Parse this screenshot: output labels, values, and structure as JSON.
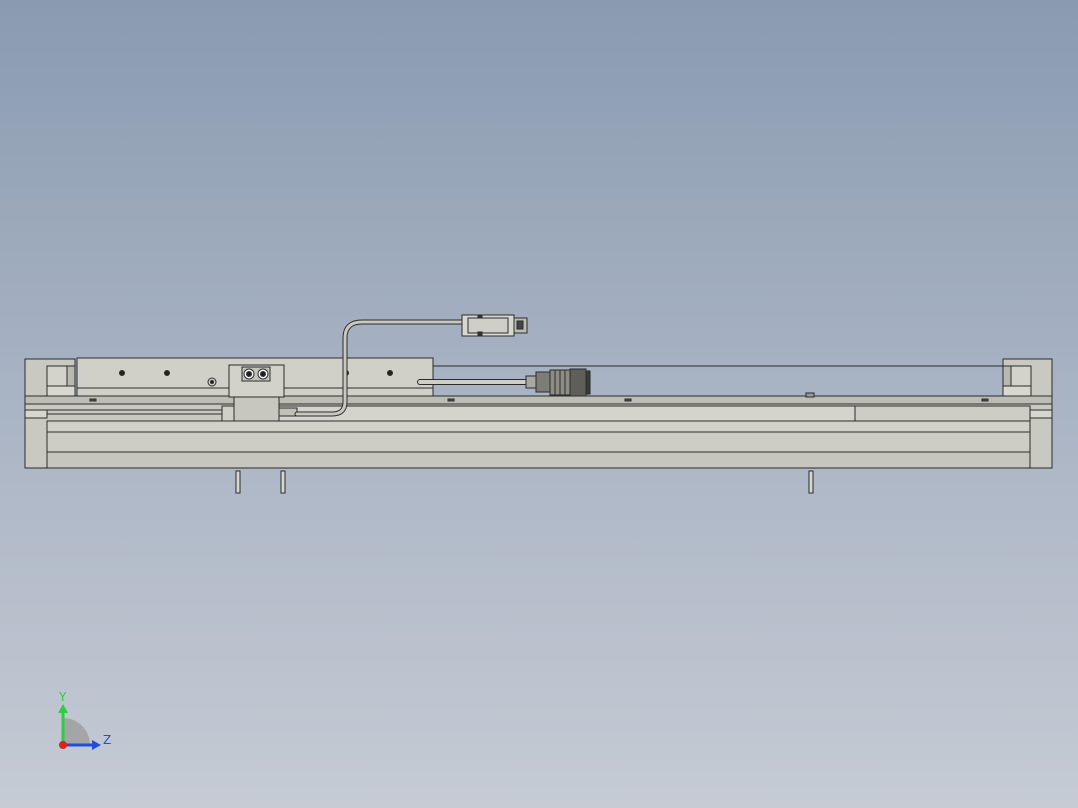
{
  "viewport": {
    "background_top": "#8a9bb0",
    "background_bottom": "#c6cbd4"
  },
  "model": {
    "body_color": "#c9c9c1",
    "edge_color": "#2b2b2b",
    "cable_color": "#bdbdb6"
  },
  "triad": {
    "y_label": "Y",
    "z_label": "Z",
    "y_color": "#2ecc40",
    "z_color": "#1f4fd8",
    "x_color": "#e02020"
  }
}
